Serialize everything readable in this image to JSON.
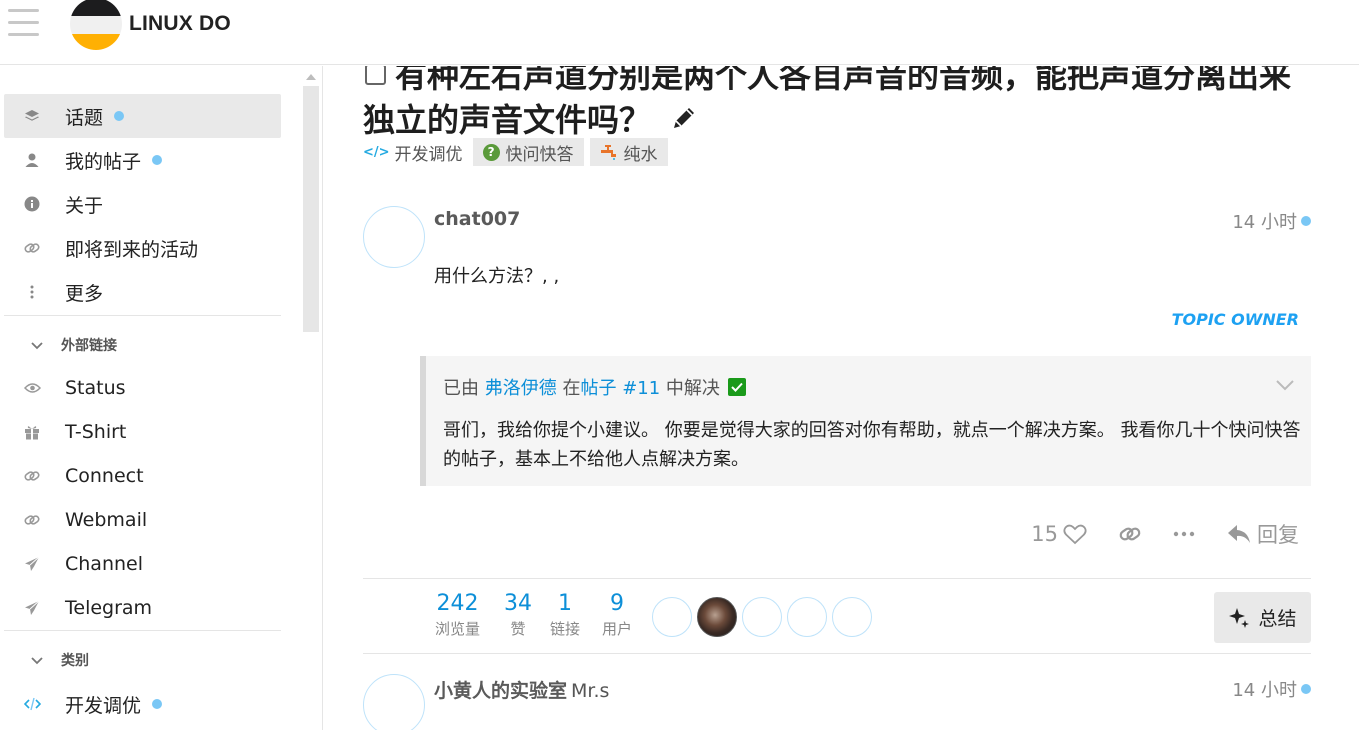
{
  "header": {
    "logo_text": "LINUX DO"
  },
  "sidebar": {
    "items": [
      {
        "label": "话题",
        "icon": "layers-icon",
        "unread": true
      },
      {
        "label": "我的帖子",
        "icon": "user-icon",
        "unread": true
      },
      {
        "label": "关于",
        "icon": "info-icon",
        "unread": false
      },
      {
        "label": "即将到来的活动",
        "icon": "link-icon",
        "unread": false
      },
      {
        "label": "更多",
        "icon": "more-vertical-icon",
        "unread": false
      }
    ],
    "external_section": "外部链接",
    "external_links": [
      {
        "label": "Status",
        "icon": "eye-icon"
      },
      {
        "label": "T-Shirt",
        "icon": "gift-icon"
      },
      {
        "label": "Connect",
        "icon": "link-icon"
      },
      {
        "label": "Webmail",
        "icon": "link-icon"
      },
      {
        "label": "Channel",
        "icon": "paper-plane-icon"
      },
      {
        "label": "Telegram",
        "icon": "paper-plane-icon"
      }
    ],
    "category_section": "类别",
    "categories": [
      {
        "label": "开发调优",
        "icon": "code-icon",
        "unread": true
      }
    ]
  },
  "topic": {
    "title_line1": "有种左右声道分别是两个人各自声音的音频，能把声道分离出来",
    "title_line2": "独立的声音文件吗？",
    "category": "开发调优",
    "tags": [
      "快问快答",
      "纯水"
    ]
  },
  "posts": [
    {
      "username": "chat007",
      "time": "14 小时",
      "body": "用什么方法？, ,",
      "owner_badge": "TOPIC OWNER",
      "solution": {
        "prefix": "已由",
        "solver": "弗洛伊德",
        "middle": "在",
        "post_link": "帖子 #11",
        "suffix": "中解决",
        "text": "哥们，我给你提个小建议。 你要是觉得大家的回答对你有帮助，就点一个解决方案。 我看你几十个快问快答的帖子，基本上不给他人点解决方案。"
      },
      "likes": "15",
      "reply_label": "回复"
    },
    {
      "username": "小黄人的实验室",
      "user_title": "Mr.s",
      "time": "14 小时"
    }
  ],
  "topic_stats": {
    "views": {
      "value": "242",
      "label": "浏览量"
    },
    "likes": {
      "value": "34",
      "label": "赞"
    },
    "links": {
      "value": "1",
      "label": "链接"
    },
    "users": {
      "value": "9",
      "label": "用户"
    },
    "summary_button": "总结"
  },
  "colors": {
    "accent_blue": "#0d8fd8",
    "unread_dot": "#7ac7f5",
    "solved_green": "#1a9a1a",
    "owner_blue": "#1da1f2"
  }
}
